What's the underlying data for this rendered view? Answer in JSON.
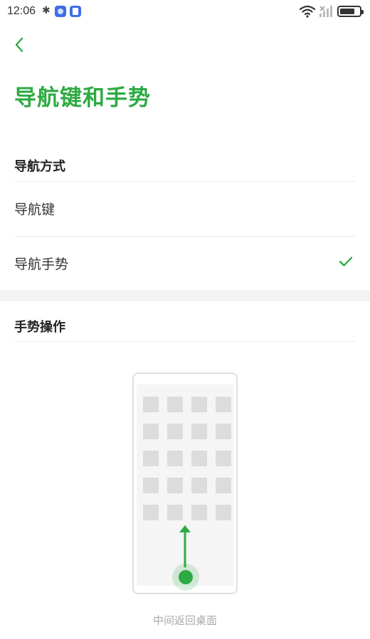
{
  "status_bar": {
    "time": "12:06",
    "bluetooth_icon": "bluetooth-icon",
    "battery_level": 0.75
  },
  "header": {
    "back_icon": "chevron-left-icon",
    "title": "导航键和手势"
  },
  "navigation_section": {
    "title": "导航方式",
    "options": [
      {
        "label": "导航键",
        "selected": false
      },
      {
        "label": "导航手势",
        "selected": true
      }
    ]
  },
  "gesture_section": {
    "title": "手势操作",
    "illustration_caption": "中间返回桌面"
  },
  "colors": {
    "accent": "#2daa43",
    "divider": "#ececec",
    "caption": "#aaaaaa"
  }
}
